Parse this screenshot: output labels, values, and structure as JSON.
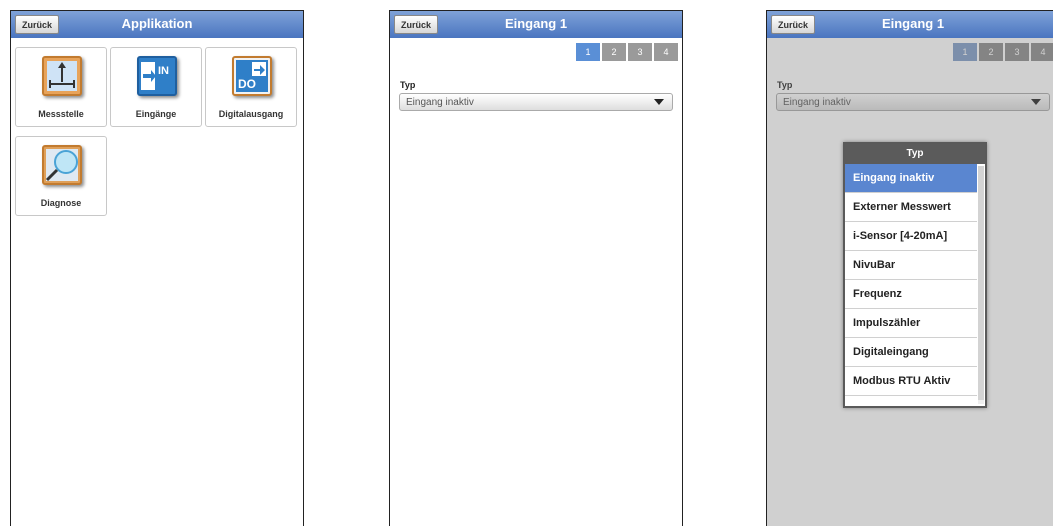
{
  "panel1": {
    "back_label": "Zurück",
    "title": "Applikation",
    "tiles": [
      {
        "label": "Messstelle",
        "icon": "measurement-point-icon"
      },
      {
        "label": "Eingänge",
        "icon": "inputs-in-icon"
      },
      {
        "label": "Digitalausgang",
        "icon": "digital-output-do-icon"
      },
      {
        "label": "Diagnose",
        "icon": "diagnose-magnifier-icon"
      }
    ],
    "icon_text": {
      "in": "IN",
      "do": "DO"
    }
  },
  "panel2": {
    "back_label": "Zurück",
    "title": "Eingang 1",
    "tabs": [
      "1",
      "2",
      "3",
      "4"
    ],
    "active_tab": "1",
    "typ_label": "Typ",
    "typ_value": "Eingang inaktiv"
  },
  "panel3": {
    "back_label": "Zurück",
    "title": "Eingang 1",
    "tabs": [
      "1",
      "2",
      "3",
      "4"
    ],
    "active_tab": "1",
    "typ_label": "Typ",
    "typ_value": "Eingang inaktiv",
    "dropdown": {
      "title": "Typ",
      "options": [
        "Eingang inaktiv",
        "Externer Messwert",
        "i-Sensor [4-20mA]",
        "NivuBar",
        "Frequenz",
        "Impulszähler",
        "Digitaleingang",
        "Modbus RTU Aktiv"
      ],
      "selected": "Eingang inaktiv"
    }
  },
  "colors": {
    "header": "#4a75c0",
    "selected_option": "#5a86d0",
    "active_tab": "#5a8fd6"
  }
}
